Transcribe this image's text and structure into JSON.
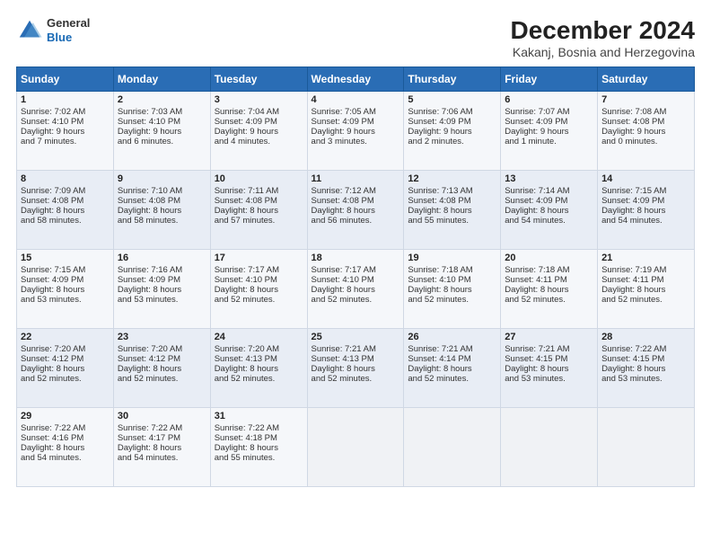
{
  "logo": {
    "general": "General",
    "blue": "Blue"
  },
  "title": "December 2024",
  "subtitle": "Kakanj, Bosnia and Herzegovina",
  "days_header": [
    "Sunday",
    "Monday",
    "Tuesday",
    "Wednesday",
    "Thursday",
    "Friday",
    "Saturday"
  ],
  "weeks": [
    [
      {
        "day": 1,
        "lines": [
          "Sunrise: 7:02 AM",
          "Sunset: 4:10 PM",
          "Daylight: 9 hours",
          "and 7 minutes."
        ]
      },
      {
        "day": 2,
        "lines": [
          "Sunrise: 7:03 AM",
          "Sunset: 4:10 PM",
          "Daylight: 9 hours",
          "and 6 minutes."
        ]
      },
      {
        "day": 3,
        "lines": [
          "Sunrise: 7:04 AM",
          "Sunset: 4:09 PM",
          "Daylight: 9 hours",
          "and 4 minutes."
        ]
      },
      {
        "day": 4,
        "lines": [
          "Sunrise: 7:05 AM",
          "Sunset: 4:09 PM",
          "Daylight: 9 hours",
          "and 3 minutes."
        ]
      },
      {
        "day": 5,
        "lines": [
          "Sunrise: 7:06 AM",
          "Sunset: 4:09 PM",
          "Daylight: 9 hours",
          "and 2 minutes."
        ]
      },
      {
        "day": 6,
        "lines": [
          "Sunrise: 7:07 AM",
          "Sunset: 4:09 PM",
          "Daylight: 9 hours",
          "and 1 minute."
        ]
      },
      {
        "day": 7,
        "lines": [
          "Sunrise: 7:08 AM",
          "Sunset: 4:08 PM",
          "Daylight: 9 hours",
          "and 0 minutes."
        ]
      }
    ],
    [
      {
        "day": 8,
        "lines": [
          "Sunrise: 7:09 AM",
          "Sunset: 4:08 PM",
          "Daylight: 8 hours",
          "and 58 minutes."
        ]
      },
      {
        "day": 9,
        "lines": [
          "Sunrise: 7:10 AM",
          "Sunset: 4:08 PM",
          "Daylight: 8 hours",
          "and 58 minutes."
        ]
      },
      {
        "day": 10,
        "lines": [
          "Sunrise: 7:11 AM",
          "Sunset: 4:08 PM",
          "Daylight: 8 hours",
          "and 57 minutes."
        ]
      },
      {
        "day": 11,
        "lines": [
          "Sunrise: 7:12 AM",
          "Sunset: 4:08 PM",
          "Daylight: 8 hours",
          "and 56 minutes."
        ]
      },
      {
        "day": 12,
        "lines": [
          "Sunrise: 7:13 AM",
          "Sunset: 4:08 PM",
          "Daylight: 8 hours",
          "and 55 minutes."
        ]
      },
      {
        "day": 13,
        "lines": [
          "Sunrise: 7:14 AM",
          "Sunset: 4:09 PM",
          "Daylight: 8 hours",
          "and 54 minutes."
        ]
      },
      {
        "day": 14,
        "lines": [
          "Sunrise: 7:15 AM",
          "Sunset: 4:09 PM",
          "Daylight: 8 hours",
          "and 54 minutes."
        ]
      }
    ],
    [
      {
        "day": 15,
        "lines": [
          "Sunrise: 7:15 AM",
          "Sunset: 4:09 PM",
          "Daylight: 8 hours",
          "and 53 minutes."
        ]
      },
      {
        "day": 16,
        "lines": [
          "Sunrise: 7:16 AM",
          "Sunset: 4:09 PM",
          "Daylight: 8 hours",
          "and 53 minutes."
        ]
      },
      {
        "day": 17,
        "lines": [
          "Sunrise: 7:17 AM",
          "Sunset: 4:10 PM",
          "Daylight: 8 hours",
          "and 52 minutes."
        ]
      },
      {
        "day": 18,
        "lines": [
          "Sunrise: 7:17 AM",
          "Sunset: 4:10 PM",
          "Daylight: 8 hours",
          "and 52 minutes."
        ]
      },
      {
        "day": 19,
        "lines": [
          "Sunrise: 7:18 AM",
          "Sunset: 4:10 PM",
          "Daylight: 8 hours",
          "and 52 minutes."
        ]
      },
      {
        "day": 20,
        "lines": [
          "Sunrise: 7:18 AM",
          "Sunset: 4:11 PM",
          "Daylight: 8 hours",
          "and 52 minutes."
        ]
      },
      {
        "day": 21,
        "lines": [
          "Sunrise: 7:19 AM",
          "Sunset: 4:11 PM",
          "Daylight: 8 hours",
          "and 52 minutes."
        ]
      }
    ],
    [
      {
        "day": 22,
        "lines": [
          "Sunrise: 7:20 AM",
          "Sunset: 4:12 PM",
          "Daylight: 8 hours",
          "and 52 minutes."
        ]
      },
      {
        "day": 23,
        "lines": [
          "Sunrise: 7:20 AM",
          "Sunset: 4:12 PM",
          "Daylight: 8 hours",
          "and 52 minutes."
        ]
      },
      {
        "day": 24,
        "lines": [
          "Sunrise: 7:20 AM",
          "Sunset: 4:13 PM",
          "Daylight: 8 hours",
          "and 52 minutes."
        ]
      },
      {
        "day": 25,
        "lines": [
          "Sunrise: 7:21 AM",
          "Sunset: 4:13 PM",
          "Daylight: 8 hours",
          "and 52 minutes."
        ]
      },
      {
        "day": 26,
        "lines": [
          "Sunrise: 7:21 AM",
          "Sunset: 4:14 PM",
          "Daylight: 8 hours",
          "and 52 minutes."
        ]
      },
      {
        "day": 27,
        "lines": [
          "Sunrise: 7:21 AM",
          "Sunset: 4:15 PM",
          "Daylight: 8 hours",
          "and 53 minutes."
        ]
      },
      {
        "day": 28,
        "lines": [
          "Sunrise: 7:22 AM",
          "Sunset: 4:15 PM",
          "Daylight: 8 hours",
          "and 53 minutes."
        ]
      }
    ],
    [
      {
        "day": 29,
        "lines": [
          "Sunrise: 7:22 AM",
          "Sunset: 4:16 PM",
          "Daylight: 8 hours",
          "and 54 minutes."
        ]
      },
      {
        "day": 30,
        "lines": [
          "Sunrise: 7:22 AM",
          "Sunset: 4:17 PM",
          "Daylight: 8 hours",
          "and 54 minutes."
        ]
      },
      {
        "day": 31,
        "lines": [
          "Sunrise: 7:22 AM",
          "Sunset: 4:18 PM",
          "Daylight: 8 hours",
          "and 55 minutes."
        ]
      },
      null,
      null,
      null,
      null
    ]
  ]
}
